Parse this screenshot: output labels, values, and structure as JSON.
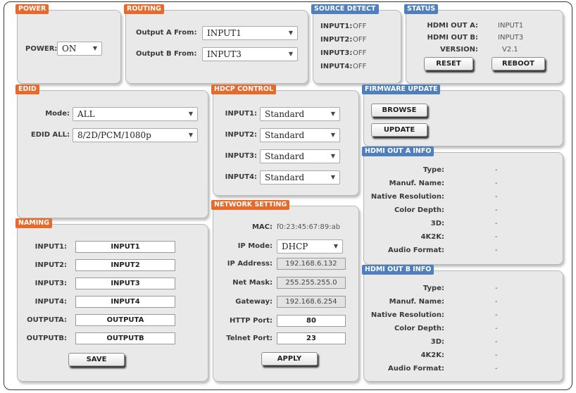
{
  "power": {
    "title": "POWER",
    "label": "POWER:",
    "value": "ON"
  },
  "routing": {
    "title": "ROUTING",
    "a_label": "Output A From:",
    "a_value": "INPUT1",
    "b_label": "Output B From:",
    "b_value": "INPUT3"
  },
  "source_detect": {
    "title": "SOURCE DETECT",
    "items": [
      {
        "label": "INPUT1:",
        "value": "OFF"
      },
      {
        "label": "INPUT2:",
        "value": "OFF"
      },
      {
        "label": "INPUT3:",
        "value": "OFF"
      },
      {
        "label": "INPUT4:",
        "value": "OFF"
      }
    ]
  },
  "status": {
    "title": "STATUS",
    "items": [
      {
        "label": "HDMI OUT A:",
        "value": "INPUT1"
      },
      {
        "label": "HDMI OUT B:",
        "value": "INPUT3"
      },
      {
        "label": "VERSION:",
        "value": "V2.1"
      }
    ],
    "reset_label": "RESET",
    "reboot_label": "REBOOT"
  },
  "edid": {
    "title": "EDID",
    "mode_label": "Mode:",
    "mode_value": "ALL",
    "all_label": "EDID ALL:",
    "all_value": "8/2D/PCM/1080p"
  },
  "hdcp": {
    "title": "HDCP CONTROL",
    "items": [
      {
        "label": "INPUT1:",
        "value": "Standard"
      },
      {
        "label": "INPUT2:",
        "value": "Standard"
      },
      {
        "label": "INPUT3:",
        "value": "Standard"
      },
      {
        "label": "INPUT4:",
        "value": "Standard"
      }
    ]
  },
  "firmware": {
    "title": "FIRMWARE UPDATE",
    "browse_label": "BROWSE",
    "update_label": "UPDATE"
  },
  "out_a": {
    "title": "HDMI OUT A INFO",
    "items": [
      {
        "label": "Type:",
        "value": "-"
      },
      {
        "label": "Manuf. Name:",
        "value": "-"
      },
      {
        "label": "Native Resolution:",
        "value": "-"
      },
      {
        "label": "Color Depth:",
        "value": "-"
      },
      {
        "label": "3D:",
        "value": "-"
      },
      {
        "label": "4K2K:",
        "value": "-"
      },
      {
        "label": "Audio Format:",
        "value": "-"
      }
    ]
  },
  "out_b": {
    "title": "HDMI OUT B INFO",
    "items": [
      {
        "label": "Type:",
        "value": "-"
      },
      {
        "label": "Manuf. Name:",
        "value": "-"
      },
      {
        "label": "Native Resolution:",
        "value": "-"
      },
      {
        "label": "Color Depth:",
        "value": "-"
      },
      {
        "label": "3D:",
        "value": "-"
      },
      {
        "label": "4K2K:",
        "value": "-"
      },
      {
        "label": "Audio Format:",
        "value": "-"
      }
    ]
  },
  "naming": {
    "title": "NAMING",
    "items": [
      {
        "label": "INPUT1:",
        "value": "INPUT1"
      },
      {
        "label": "INPUT2:",
        "value": "INPUT2"
      },
      {
        "label": "INPUT3:",
        "value": "INPUT3"
      },
      {
        "label": "INPUT4:",
        "value": "INPUT4"
      },
      {
        "label": "OUTPUTA:",
        "value": "OUTPUTA"
      },
      {
        "label": "OUTPUTB:",
        "value": "OUTPUTB"
      }
    ],
    "save_label": "SAVE"
  },
  "network": {
    "title": "NETWORK SETTING",
    "mac_label": "MAC:",
    "mac_value": "f0:23:45:67:89:ab",
    "ipmode_label": "IP Mode:",
    "ipmode_value": "DHCP",
    "ip_label": "IP Address:",
    "ip_value": "192.168.6.132",
    "mask_label": "Net Mask:",
    "mask_value": "255.255.255.0",
    "gw_label": "Gateway:",
    "gw_value": "192.168.6.254",
    "http_label": "HTTP Port:",
    "http_value": "80",
    "telnet_label": "Telnet Port:",
    "telnet_value": "23",
    "apply_label": "APPLY"
  },
  "dropdown_icon": "chevron-down-icon",
  "colors": {
    "tag_orange": "#e86a2a",
    "tag_blue": "#4f7fbd",
    "panel_bg": "#e9e9e9"
  }
}
